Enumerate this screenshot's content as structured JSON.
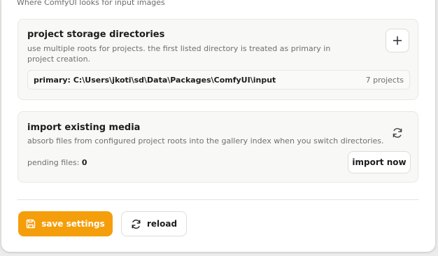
{
  "top_hint": "Where ComfyUI looks for input images",
  "storage": {
    "title": "project storage directories",
    "description": "use multiple roots for projects. the first listed directory is treated as primary in project creation.",
    "add_icon": "plus-icon",
    "directories": [
      {
        "path": "primary: C:\\Users\\jkoti\\sd\\Data\\Packages\\ComfyUI\\input",
        "count": "7 projects"
      }
    ]
  },
  "import": {
    "title": "import existing media",
    "description": "absorb files from configured project roots into the gallery index when you switch directories.",
    "refresh_icon": "refresh-icon",
    "pending_label": "pending files:",
    "pending_count": "0",
    "import_button": "import now"
  },
  "actions": {
    "save_label": "save settings",
    "save_icon": "floppy-disk-icon",
    "reload_label": "reload",
    "reload_icon": "refresh-icon"
  },
  "colors": {
    "accent": "#f59e0b",
    "card_bg": "#f8f8f6",
    "text_primary": "#1d1d1d",
    "text_muted": "#6f6f6f"
  }
}
